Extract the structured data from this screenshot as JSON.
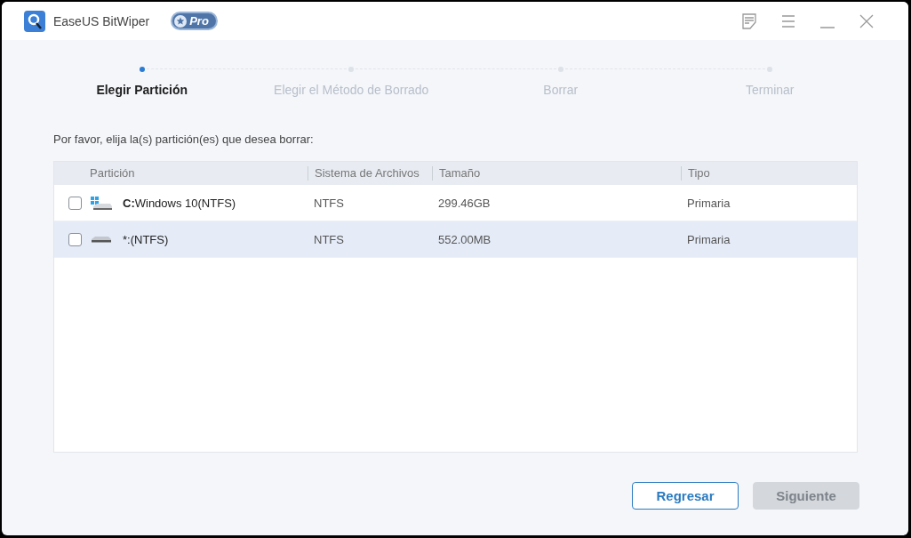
{
  "window": {
    "title": "EaseUS BitWiper",
    "badge": "Pro"
  },
  "steps": [
    {
      "label": "Elegir Partición",
      "selected": true
    },
    {
      "label": "Elegir el Método de Borrado",
      "selected": false
    },
    {
      "label": "Borrar",
      "selected": false
    },
    {
      "label": "Terminar",
      "selected": false
    }
  ],
  "instruction": "Por favor, elija la(s) partición(es) que desea borrar:",
  "table": {
    "columns": [
      "Partición",
      "Sistema de Archivos",
      "Tamaño",
      "Tipo"
    ],
    "rows": [
      {
        "kind": "system",
        "checked": false,
        "selected": false,
        "name": "**C:**Windows 10(NTFS)",
        "fs": "NTFS",
        "size": "299.46GB",
        "type": "Primaria"
      },
      {
        "kind": "data",
        "checked": false,
        "selected": true,
        "name": "*:(NTFS)",
        "fs": "NTFS",
        "size": "552.00MB",
        "type": "Primaria"
      }
    ]
  },
  "buttons": [
    {
      "label": "Regresar",
      "disabled": false
    },
    {
      "label": "Siguiente",
      "disabled": true
    }
  ]
}
